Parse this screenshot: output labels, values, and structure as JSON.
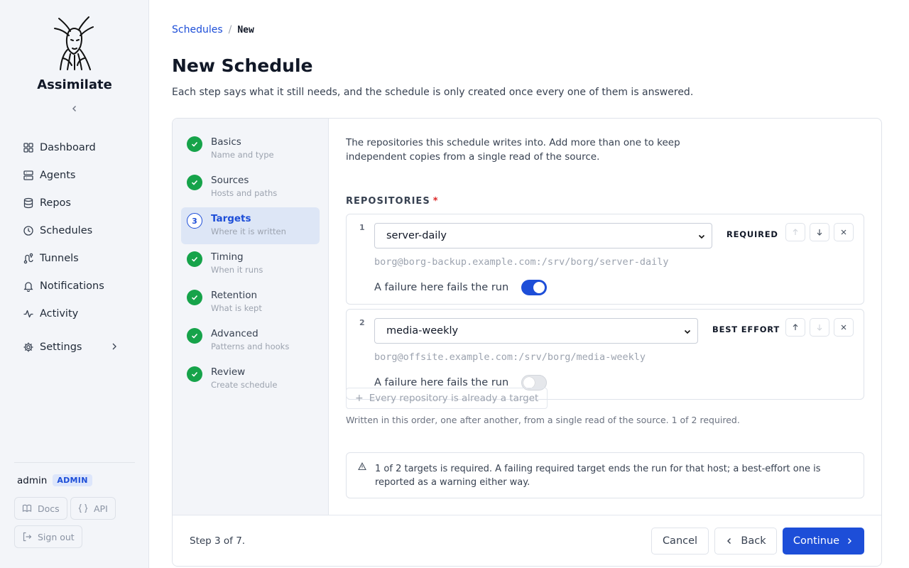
{
  "app": {
    "name": "Assimilate"
  },
  "sidebar": {
    "items": [
      {
        "label": "Dashboard",
        "icon": "grid-icon"
      },
      {
        "label": "Agents",
        "icon": "server-icon"
      },
      {
        "label": "Repos",
        "icon": "database-icon"
      },
      {
        "label": "Schedules",
        "icon": "clock-icon"
      },
      {
        "label": "Tunnels",
        "icon": "route-icon"
      },
      {
        "label": "Notifications",
        "icon": "bell-icon"
      },
      {
        "label": "Activity",
        "icon": "activity-icon"
      },
      {
        "label": "Settings",
        "icon": "gear-icon"
      }
    ],
    "user": {
      "name": "admin",
      "role": "ADMIN"
    },
    "docs_label": "Docs",
    "api_label": "API",
    "signout_label": "Sign out"
  },
  "breadcrumb": {
    "parent": "Schedules",
    "separator": "/",
    "current": "New"
  },
  "page": {
    "title": "New Schedule",
    "subtitle": "Each step says what it still needs, and the schedule is only created once every one of them is answered."
  },
  "steps": [
    {
      "title": "Basics",
      "desc": "Name and type",
      "status": "done"
    },
    {
      "title": "Sources",
      "desc": "Hosts and paths",
      "status": "done"
    },
    {
      "title": "Targets",
      "desc": "Where it is written",
      "status": "current",
      "number": "3"
    },
    {
      "title": "Timing",
      "desc": "When it runs",
      "status": "done"
    },
    {
      "title": "Retention",
      "desc": "What is kept",
      "status": "done"
    },
    {
      "title": "Advanced",
      "desc": "Patterns and hooks",
      "status": "done"
    },
    {
      "title": "Review",
      "desc": "Create schedule",
      "status": "done"
    }
  ],
  "targets": {
    "intro": "The repositories this schedule writes into. Add more than one to keep independent copies from a single read of the source.",
    "section_label": "REPOSITORIES",
    "required_mark": "*",
    "repos": [
      {
        "index": "1",
        "name": "server-daily",
        "badge": "REQUIRED",
        "path": "borg@borg-backup.example.com:/srv/borg/server-daily",
        "toggle_label": "A failure here fails the run",
        "fails_run": true
      },
      {
        "index": "2",
        "name": "media-weekly",
        "badge": "BEST EFFORT",
        "path": "borg@offsite.example.com:/srv/borg/media-weekly",
        "toggle_label": "A failure here fails the run",
        "fails_run": false
      }
    ],
    "add_label": "Every repository is already a target",
    "order_note": "Written in this order, one after another, from a single read of the source. 1 of 2 required.",
    "info": "1 of 2 targets is required. A failing required target ends the run for that host; a best-effort one is reported as a warning either way."
  },
  "footer": {
    "step_count": "Step 3 of 7.",
    "cancel_label": "Cancel",
    "back_label": "Back",
    "continue_label": "Continue"
  },
  "colors": {
    "accent": "#1d4ed8",
    "success": "#16a34a",
    "danger": "#dc2626"
  }
}
